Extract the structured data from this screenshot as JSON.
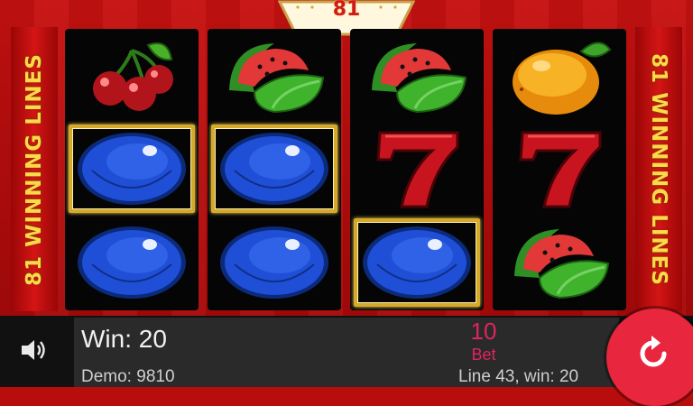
{
  "game": {
    "logo_text": "81",
    "side_banner_text": "81 WINNING LINES"
  },
  "reels": [
    [
      "cherries-icon",
      "blue-plum-icon",
      "blue-plum-icon"
    ],
    [
      "watermelon-icon",
      "blue-plum-icon",
      "blue-plum-icon"
    ],
    [
      "watermelon-icon",
      "seven-icon",
      "blue-plum-icon"
    ],
    [
      "orange-icon",
      "seven-icon",
      "watermelon-icon"
    ]
  ],
  "winning_cells": [
    [
      0,
      1
    ],
    [
      1,
      1
    ],
    [
      2,
      2
    ]
  ],
  "panel": {
    "win_label": "Win:",
    "win_value": "20",
    "bet_value": "10",
    "bet_label": "Bet",
    "demo_label": "Demo:",
    "demo_value": "9810",
    "line_info": "Line 43, win: 20"
  },
  "colors": {
    "background": "#b80d0d",
    "win_frame": "#d6a92b",
    "accent": "#e0245e",
    "spin_button": "#e8263d"
  }
}
